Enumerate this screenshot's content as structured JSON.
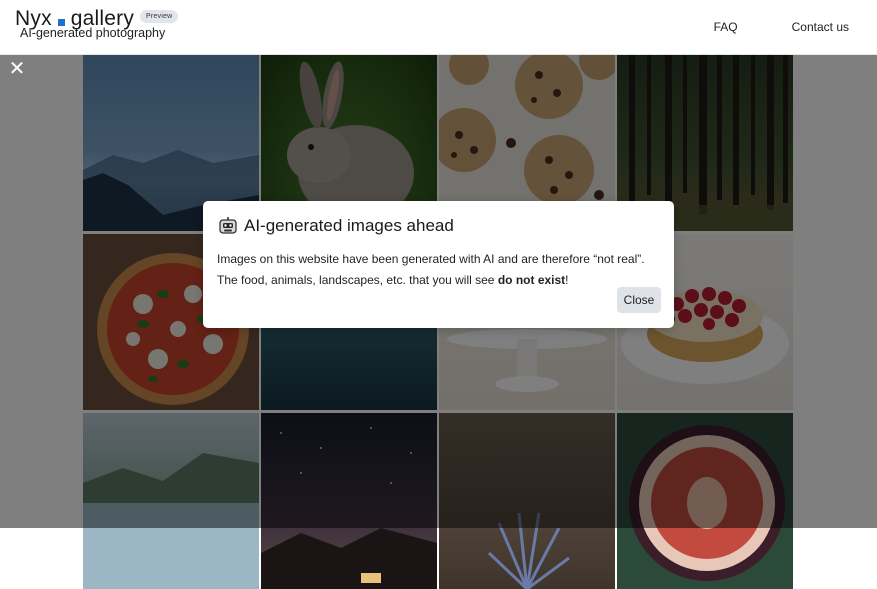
{
  "header": {
    "brand_left": "Nyx",
    "brand_right": "gallery",
    "badge": "Preview",
    "subtitle": "AI-generated photography",
    "nav": [
      "FAQ",
      "Contact us"
    ]
  },
  "gallery": {
    "tiles": [
      {
        "subject": "mountains at dusk"
      },
      {
        "subject": "rabbit"
      },
      {
        "subject": "chocolate chip cookies"
      },
      {
        "subject": "forest"
      },
      {
        "subject": "pizza"
      },
      {
        "subject": "water"
      },
      {
        "subject": "cake on stand"
      },
      {
        "subject": "raspberry tart"
      },
      {
        "subject": "lake and mountains"
      },
      {
        "subject": "night sky"
      },
      {
        "subject": "plant"
      },
      {
        "subject": "fig"
      }
    ]
  },
  "overlay": {
    "close_icon": "close-icon"
  },
  "modal": {
    "icon": "robot-icon",
    "title": "AI-generated images ahead",
    "line1": "Images on this website have been generated with AI and are therefore “not real”.",
    "line2_prefix": "The food, animals, landscapes, etc. that you will see ",
    "line2_bold": "do not exist",
    "line2_suffix": "!",
    "close_label": "Close"
  }
}
